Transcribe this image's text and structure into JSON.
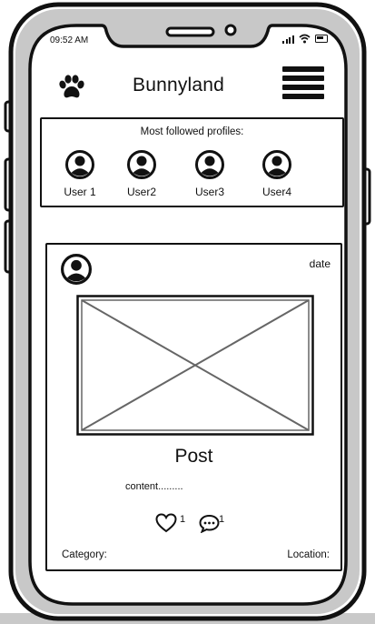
{
  "status_bar": {
    "time": "09:52 AM",
    "signal_icon": "signal-bars-icon",
    "wifi_icon": "wifi-icon",
    "battery_icon": "battery-icon"
  },
  "header": {
    "logo_icon": "paw-icon",
    "title": "Bunnyland",
    "menu_icon": "hamburger-menu-icon"
  },
  "followed": {
    "heading": "Most followed profiles:",
    "profiles": [
      {
        "label": "User 1",
        "icon": "user-avatar-icon"
      },
      {
        "label": "User2",
        "icon": "user-avatar-icon"
      },
      {
        "label": "User3",
        "icon": "user-avatar-icon"
      },
      {
        "label": "User4",
        "icon": "user-avatar-icon"
      }
    ]
  },
  "post": {
    "avatar_icon": "user-avatar-icon",
    "date": "date",
    "image_icon": "image-placeholder-icon",
    "title": "Post",
    "content": "content.........",
    "like_icon": "heart-icon",
    "likes": "1",
    "comment_icon": "comment-icon",
    "comments": "1",
    "category_label": "Category:",
    "location_label": "Location:"
  },
  "colors": {
    "ink": "#111111",
    "background": "#ffffff",
    "floor": "#c9c9c9"
  }
}
